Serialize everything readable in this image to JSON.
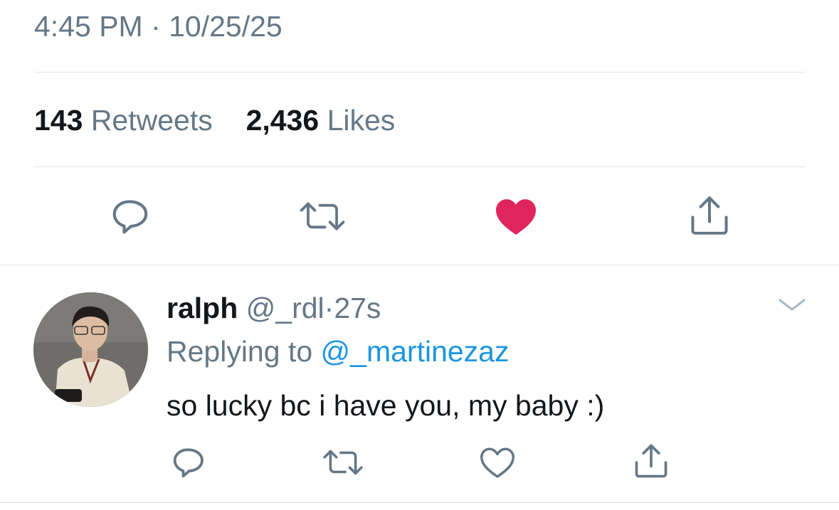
{
  "tweet": {
    "timestamp": "4:45 PM · 10/25/25",
    "stats": {
      "retweets_count": "143",
      "retweets_label": "Retweets",
      "likes_count": "2,436",
      "likes_label": "Likes"
    },
    "actions": {
      "reply": "reply-icon",
      "retweet": "retweet-icon",
      "like": "heart-filled-icon",
      "share": "share-icon"
    },
    "liked": true
  },
  "reply_tweet": {
    "display_name": "ralph",
    "handle": "@_rdl",
    "separator": "·",
    "time": "27s",
    "replying_to_label": "Replying to",
    "replying_to_handle": "@_martinezaz",
    "text": "so lucky bc i have you, my baby :)",
    "actions": {
      "reply": "reply-icon",
      "retweet": "retweet-icon",
      "like": "heart-outline-icon",
      "share": "share-icon"
    },
    "more": "chevron-down-icon"
  },
  "colors": {
    "secondary_text": "#657786",
    "link": "#1b95e0",
    "like_active": "#e0245e",
    "divider": "#e1e8ed"
  }
}
